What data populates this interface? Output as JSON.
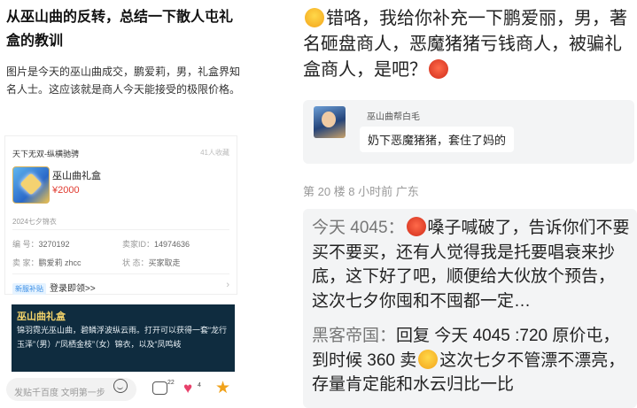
{
  "left": {
    "title": "从巫山曲的反转，总结一下散人屯礼盒的教训",
    "body": "图片是今天的巫山曲成交，鹏爱莉，男，礼盒界知名人士。这应该就是商人今天能接受的极限价格。",
    "card": {
      "header": "天下无双-纵横驰骋",
      "views": "41人收藏",
      "item_name": "巫山曲礼盒",
      "item_price": "¥2000",
      "season": "2024七夕锦衣",
      "number_label": "编   号：",
      "number_value": "3270192",
      "seller_id_label": "卖家ID：",
      "seller_id_value": "14974636",
      "seller_label": "卖   家：",
      "seller_value": "鹏爱莉 zhcc",
      "status_label": "状   态：",
      "status_value": "买家取走",
      "entry_tag": "新服补贴",
      "entry_text": "登录即领>>",
      "entry_arrow": "›"
    },
    "promo": {
      "title": "巫山曲礼盒",
      "desc": "锦羽霓光巫山曲，碧鳞浮波纵云雨。打开可以获得一套“龙行玉泽”（男）/“凤栖金枝”（女）锦衣，以及“凤鸣岐"
    },
    "bottom": {
      "input_placeholder": "发贴千百度 文明第一步",
      "comment_count": "22",
      "like_count": "4"
    }
  },
  "right": {
    "reply_a": "错咯，我给你补充一下鹏爱丽，男，著名砸盘商人，恶魔猪猪亏钱商人，被骗礼盒商人，是吧？",
    "quote": {
      "name": "巫山曲帮白毛",
      "text": "奶下恶魔猪猪，套住了妈的"
    },
    "meta": "第 20 楼   8 小时前   广东",
    "comments": [
      {
        "name": "今天 4045：",
        "text": "嗓子喊破了，告诉你们不要买不要买，还有人觉得我是托要唱衰来抄底，这下好了吧，顺便给大伙放个预告，这次七夕你囤和不囤都一定…"
      },
      {
        "name": "黑客帝国：",
        "text_a": "回复 今天 4045 :720 原价屯，到时候 360 卖",
        "text_b": "这次七夕不管漂不漂亮，存量肯定能和水云归比一比"
      }
    ]
  }
}
